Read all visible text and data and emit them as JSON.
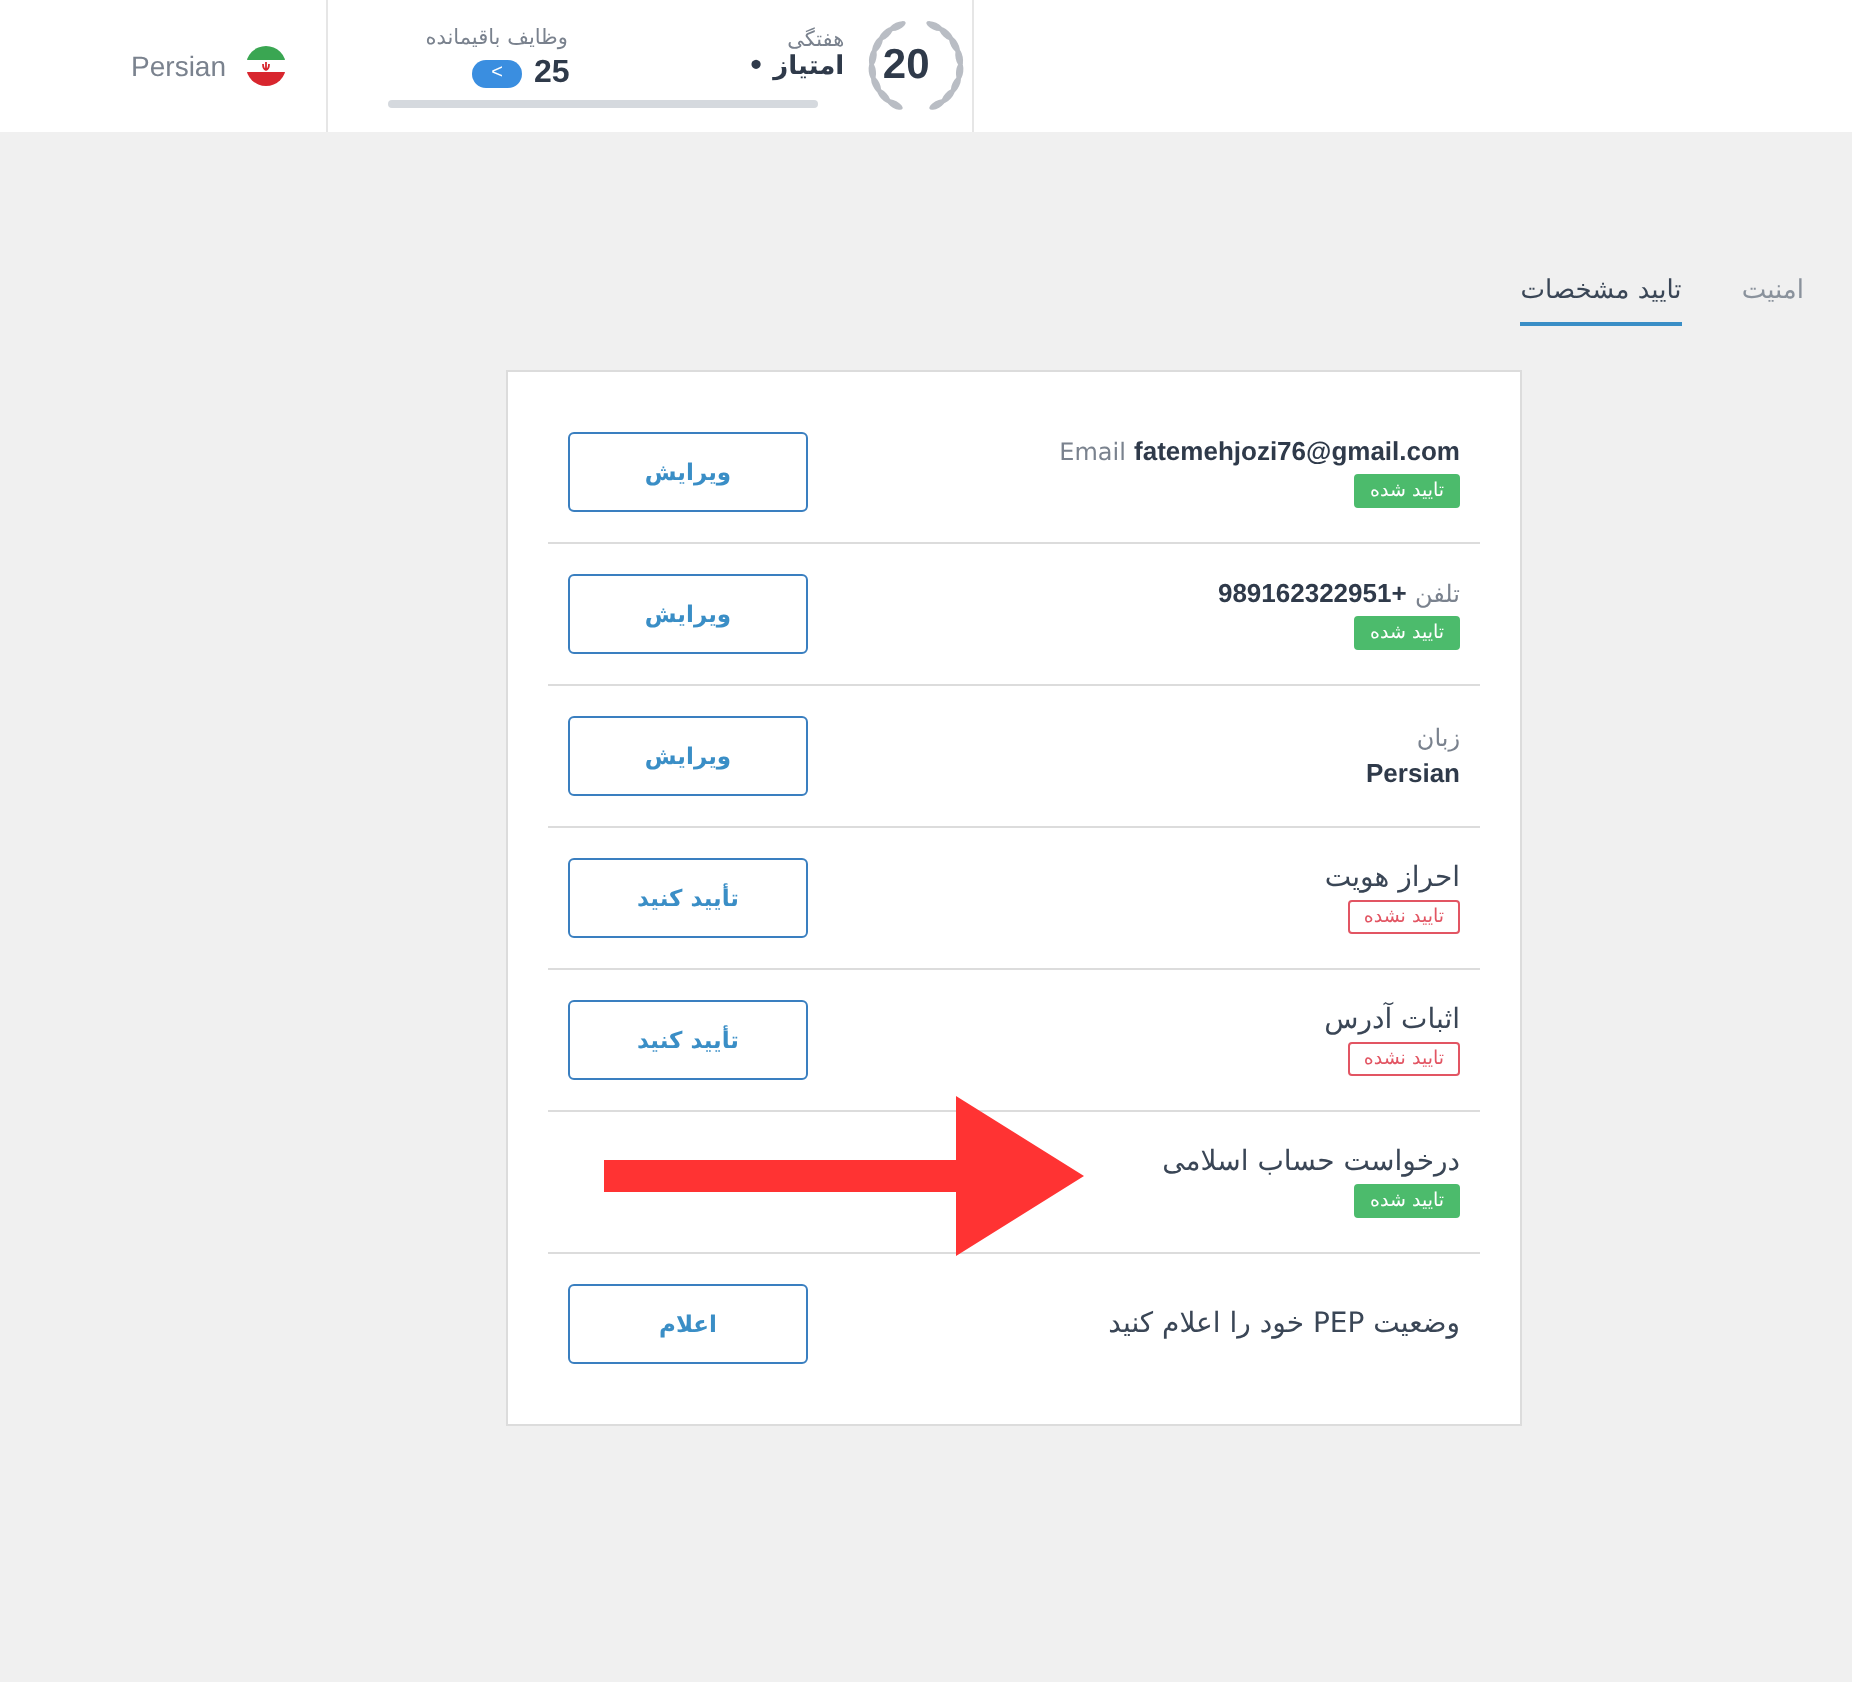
{
  "header": {
    "language": "Persian",
    "tasks": {
      "label": "وظایف باقیمانده",
      "count": "25",
      "button": "<"
    },
    "score": {
      "period": "هفتگی",
      "label": "• امتیاز",
      "points": "20"
    }
  },
  "tabs": [
    {
      "label": "امنیت",
      "selected": false
    },
    {
      "label": "تایید مشخصات",
      "selected": true
    }
  ],
  "rows": [
    {
      "kind": "inline",
      "label": "Email",
      "value": "fatemehjozi76@gmail.com",
      "verified": true,
      "status": "تایید شده",
      "button": "ویرایش"
    },
    {
      "kind": "inline",
      "label": "تلفن",
      "value": "+989162322951",
      "verified": true,
      "status": "تایید شده",
      "button": "ویرایش"
    },
    {
      "kind": "stacked",
      "label": "زبان",
      "value": "Persian",
      "button": "ویرایش"
    },
    {
      "kind": "title",
      "label": "احراز هویت",
      "verified": false,
      "status": "تایید نشده",
      "button": "تأیید کنید"
    },
    {
      "kind": "title",
      "label": "اثبات آدرس",
      "verified": false,
      "status": "تایید نشده",
      "button": "تأیید کنید"
    },
    {
      "kind": "title",
      "label": "درخواست حساب اسلامی",
      "verified": true,
      "status": "تایید شده",
      "annotated": true
    },
    {
      "kind": "title",
      "label": "وضعیت PEP خود را اعلام کنید",
      "button": "اعلام"
    }
  ]
}
